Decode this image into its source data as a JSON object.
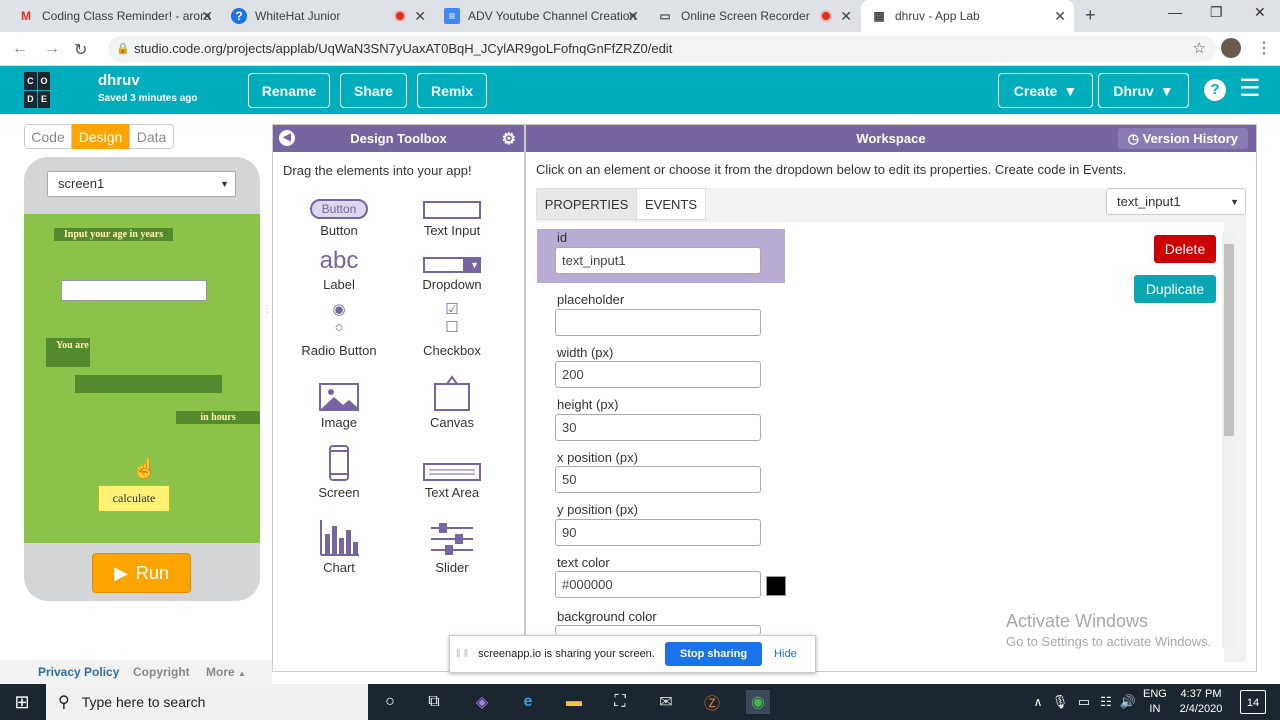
{
  "browser": {
    "tabs": [
      {
        "title": "Coding Class Reminder! - arora",
        "icon": "gmail-icon",
        "recording": false
      },
      {
        "title": "WhiteHat Junior",
        "icon": "whitehat-icon",
        "recording": true
      },
      {
        "title": "ADV Youtube Channel Creation",
        "icon": "docs-icon",
        "recording": false
      },
      {
        "title": "Online Screen Recorder",
        "icon": "monitor-icon",
        "recording": true
      },
      {
        "title": "dhruv - App Lab",
        "icon": "applab-icon",
        "recording": false,
        "active": true
      }
    ],
    "url": "studio.code.org/projects/applab/UqWaN3SN7yUaxAT0BqH_JCylAR9goLFofnqGnFfZRZ0/edit"
  },
  "header": {
    "logo": [
      "C",
      "O",
      "D",
      "E"
    ],
    "project_name": "dhruv",
    "saved": "Saved 3 minutes ago",
    "buttons": {
      "rename": "Rename",
      "share": "Share",
      "remix": "Remix",
      "create": "Create",
      "user": "Dhruv"
    }
  },
  "left": {
    "modes": {
      "code": "Code",
      "design": "Design",
      "data": "Data"
    },
    "screen_select": "screen1",
    "app": {
      "input_label": "Input your age in years",
      "you_are": "You are",
      "in_hours": "in hours",
      "calculate": "calculate"
    },
    "run": "Run",
    "footer": {
      "privacy": "Privacy Policy",
      "copyright": "Copyright",
      "more": "More"
    }
  },
  "toolbox": {
    "title": "Design Toolbox",
    "hint": "Drag the elements into your app!",
    "items": [
      "Button",
      "Text Input",
      "Label",
      "Dropdown",
      "Radio Button",
      "Checkbox",
      "Image",
      "Canvas",
      "Screen",
      "Text Area",
      "Chart",
      "Slider"
    ],
    "button_preview": "Button",
    "label_preview": "abc"
  },
  "workspace": {
    "title": "Workspace",
    "version_history": "Version History",
    "hint": "Click on an element or choose it from the dropdown below to edit its properties. Create code in Events.",
    "tabs": {
      "properties": "PROPERTIES",
      "events": "EVENTS"
    },
    "element_select": "text_input1",
    "delete": "Delete",
    "duplicate": "Duplicate",
    "props": {
      "id_label": "id",
      "id": "text_input1",
      "placeholder_label": "placeholder",
      "placeholder": "",
      "width_label": "width (px)",
      "width": "200",
      "height_label": "height (px)",
      "height": "30",
      "x_label": "x position (px)",
      "x": "50",
      "y_label": "y position (px)",
      "y": "90",
      "text_color_label": "text color",
      "text_color": "#000000",
      "bg_color_label": "background color"
    },
    "watermark": {
      "line1": "Activate Windows",
      "line2": "Go to Settings to activate Windows."
    }
  },
  "sharing": {
    "text": "screenapp.io is sharing your screen.",
    "stop": "Stop sharing",
    "hide": "Hide"
  },
  "taskbar": {
    "search": "Type here to search",
    "lang1": "ENG",
    "lang2": "IN",
    "time": "4:37 PM",
    "date": "2/4/2020",
    "notif": "14"
  },
  "colors": {
    "teal": "#00adbc",
    "purple": "#7665a0",
    "orange": "#ffa400",
    "app_bg": "#8bc34a",
    "delete": "#c00",
    "duplicate": "#0aa6b3"
  }
}
